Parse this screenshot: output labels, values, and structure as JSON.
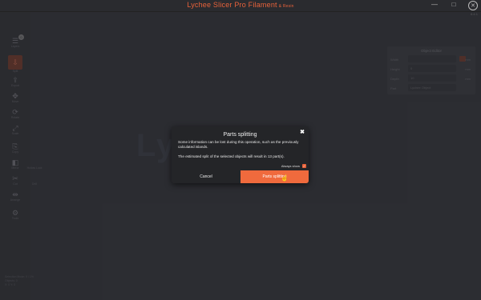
{
  "app": {
    "title": "Lychee Slicer Pro Filament",
    "subtitle": "& Resin",
    "version": "6.4.1",
    "window_minimize": "—",
    "window_maximize": "□",
    "window_close": "✕"
  },
  "sidebar": {
    "badge": "0",
    "items": [
      {
        "icon": "☰",
        "label": "Layers"
      },
      {
        "icon": "⇩",
        "label": "Split"
      },
      {
        "icon": "⇪",
        "label": "Export"
      },
      {
        "icon": "✥",
        "label": "Move"
      },
      {
        "icon": "⟳",
        "label": "Rotate"
      },
      {
        "icon": "⤢",
        "label": "Scale"
      },
      {
        "icon": "⎘",
        "label": "Copy"
      },
      {
        "icon": "◧",
        "label": "Mirror"
      },
      {
        "icon": "✂",
        "label": "Cut"
      },
      {
        "icon": "⇹",
        "label": "Arrange"
      },
      {
        "icon": "⚙",
        "label": "Tools"
      }
    ],
    "extra": [
      "Hollow Lock",
      "Drill"
    ]
  },
  "object_editor": {
    "title": "Object Editor",
    "rows": [
      {
        "key": "Width",
        "value": "",
        "unit": "mm"
      },
      {
        "key": "Height",
        "value": "0",
        "unit": "mm"
      },
      {
        "key": "Depth",
        "value": "10",
        "unit": "mm"
      },
      {
        "key": "Part",
        "value": "Lychee Object",
        "unit": ""
      }
    ]
  },
  "watermark": "Lychee",
  "status": [
    "Selection Mode: 0 / 1%",
    "Objects: 0",
    "X: 0 Y: 0"
  ],
  "dialog": {
    "title": "Parts splitting",
    "close": "✖",
    "body1": "Some information can be lost during this operation, such as the previously calculated islands.",
    "body2": "The estimated split of the selected objects will result in 13 part(s).",
    "always_show": "Always show",
    "check": "✓",
    "cancel": "Cancel",
    "confirm": "Parts splitting",
    "accent": "#f06a3d"
  }
}
